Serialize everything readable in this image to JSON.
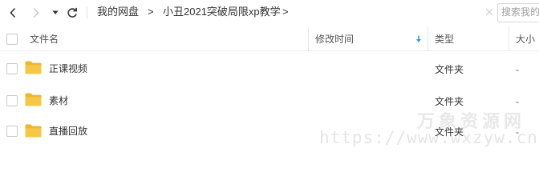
{
  "toolbar": {
    "breadcrumbs": [
      "我的网盘",
      "小丑2021突破局限xp教学"
    ],
    "breadcrumb_separator": ">",
    "search_placeholder": "搜索我的网盘文件"
  },
  "table": {
    "columns": [
      "文件名",
      "修改时间",
      "类型",
      "大小"
    ],
    "sort_indicator": "down-arrow",
    "rows": [
      {
        "name": "正课视频",
        "type": "文件夹",
        "size": "-"
      },
      {
        "name": "素材",
        "type": "文件夹",
        "size": "-"
      },
      {
        "name": "直播回放",
        "type": "文件夹",
        "size": "-"
      }
    ]
  },
  "watermark": {
    "line1": "万象资源网",
    "line2": "https://www.wxzyw.cn"
  },
  "colors": {
    "folder": "#f6c744",
    "folder_back": "#eeb52e",
    "sort_arrow": "#1e9fe6",
    "nav_active": "#333333",
    "nav_disabled": "#c8c8c8"
  }
}
